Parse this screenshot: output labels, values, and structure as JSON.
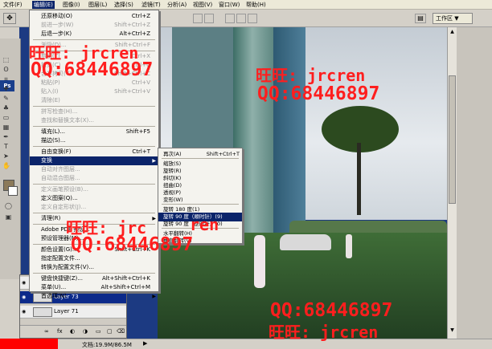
{
  "menubar": {
    "items": [
      "文件(F)",
      "编辑(E)",
      "图像(I)",
      "图层(L)",
      "选择(S)",
      "滤镜(T)",
      "分析(A)",
      "视图(V)",
      "窗口(W)",
      "帮助(H)"
    ]
  },
  "options": {
    "workspace_label": "工作区 ▼"
  },
  "toolbox": {
    "ps_label": "Ps"
  },
  "edit_menu": {
    "items": [
      {
        "label": "还原移动(O)",
        "shortcut": "Ctrl+Z",
        "disabled": false
      },
      {
        "label": "前进一步(W)",
        "shortcut": "Shift+Ctrl+Z",
        "disabled": true
      },
      {
        "label": "后退一步(K)",
        "shortcut": "Alt+Ctrl+Z",
        "disabled": false
      },
      {
        "label": "渐隐(D)...",
        "shortcut": "Shift+Ctrl+F",
        "disabled": true
      },
      {
        "label": "剪切(T)",
        "shortcut": "Ctrl+X",
        "disabled": true
      },
      {
        "label": "拷贝(C)",
        "shortcut": "Ctrl+C",
        "disabled": true
      },
      {
        "label": "合并拷贝(Y)",
        "shortcut": "Shift+Ctrl+C",
        "disabled": true
      },
      {
        "label": "粘贴(P)",
        "shortcut": "Ctrl+V",
        "disabled": true
      },
      {
        "label": "贴入(I)",
        "shortcut": "Shift+Ctrl+V",
        "disabled": true
      },
      {
        "label": "清除(E)",
        "shortcut": "",
        "disabled": true
      },
      {
        "label": "拼写检查(H)...",
        "shortcut": "",
        "disabled": true
      },
      {
        "label": "查找和替换文本(X)...",
        "shortcut": "",
        "disabled": true
      },
      {
        "label": "填充(L)...",
        "shortcut": "Shift+F5",
        "disabled": false
      },
      {
        "label": "描边(S)...",
        "shortcut": "",
        "disabled": false
      },
      {
        "label": "自由变换(F)",
        "shortcut": "Ctrl+T",
        "disabled": false
      },
      {
        "label": "变换",
        "shortcut": "",
        "disabled": false,
        "selected": true,
        "submenu": true
      },
      {
        "label": "自动对齐图层...",
        "shortcut": "",
        "disabled": true
      },
      {
        "label": "自动混合图层...",
        "shortcut": "",
        "disabled": true
      },
      {
        "label": "定义画笔预设(B)...",
        "shortcut": "",
        "disabled": true
      },
      {
        "label": "定义图案(Q)...",
        "shortcut": "",
        "disabled": false
      },
      {
        "label": "定义自定形状(J)...",
        "shortcut": "",
        "disabled": true
      },
      {
        "label": "清理(R)",
        "shortcut": "",
        "disabled": false,
        "submenu": true
      },
      {
        "label": "Adobe PDF 预设...",
        "shortcut": "",
        "disabled": false
      },
      {
        "label": "预设管理器(M)...",
        "shortcut": "",
        "disabled": false
      },
      {
        "label": "颜色设置(G)...",
        "shortcut": "Shift+Ctrl+K",
        "disabled": false
      },
      {
        "label": "指定配置文件...",
        "shortcut": "",
        "disabled": false
      },
      {
        "label": "转换为配置文件(V)...",
        "shortcut": "",
        "disabled": false
      },
      {
        "label": "键盘快捷键(Z)...",
        "shortcut": "Alt+Shift+Ctrl+K",
        "disabled": false
      },
      {
        "label": "菜单(U)...",
        "shortcut": "Alt+Shift+Ctrl+M",
        "disabled": false
      },
      {
        "label": "首选项(N)",
        "shortcut": "",
        "disabled": false,
        "submenu": true
      }
    ]
  },
  "transform_submenu": {
    "items": [
      {
        "label": "再次(A)",
        "shortcut": "Shift+Ctrl+T"
      },
      {
        "label": "缩放(S)",
        "shortcut": ""
      },
      {
        "label": "旋转(R)",
        "shortcut": ""
      },
      {
        "label": "斜切(K)",
        "shortcut": ""
      },
      {
        "label": "扭曲(D)",
        "shortcut": ""
      },
      {
        "label": "透视(P)",
        "shortcut": ""
      },
      {
        "label": "变形(W)",
        "shortcut": ""
      },
      {
        "label": "旋转 180 度(1)",
        "shortcut": ""
      },
      {
        "label": "旋转 90 度（顺时针）(9)",
        "shortcut": "",
        "selected": true
      },
      {
        "label": "旋转 90 度（逆时针）(0)",
        "shortcut": ""
      },
      {
        "label": "水平翻转(H)",
        "shortcut": ""
      },
      {
        "label": "垂直翻转(V)",
        "shortcut": ""
      }
    ]
  },
  "layers": {
    "rows": [
      {
        "name": "",
        "selected": false
      },
      {
        "name": "Layer 73",
        "selected": true
      },
      {
        "name": "Layer 71",
        "selected": false
      }
    ]
  },
  "status": {
    "doc_info": "文档:19.9M/86.5M"
  },
  "watermarks": {
    "wangwang": "旺旺: jrcren",
    "qq": "QQ:68446897",
    "wang_partial": "旺旺: jrc",
    "wang_partial2": "ren"
  },
  "colors": {
    "watermark": "#ff1e1e",
    "menu_highlight": "#0b246a",
    "layer_highlight": "#0c2a8a",
    "red_box": "#ff0000"
  }
}
